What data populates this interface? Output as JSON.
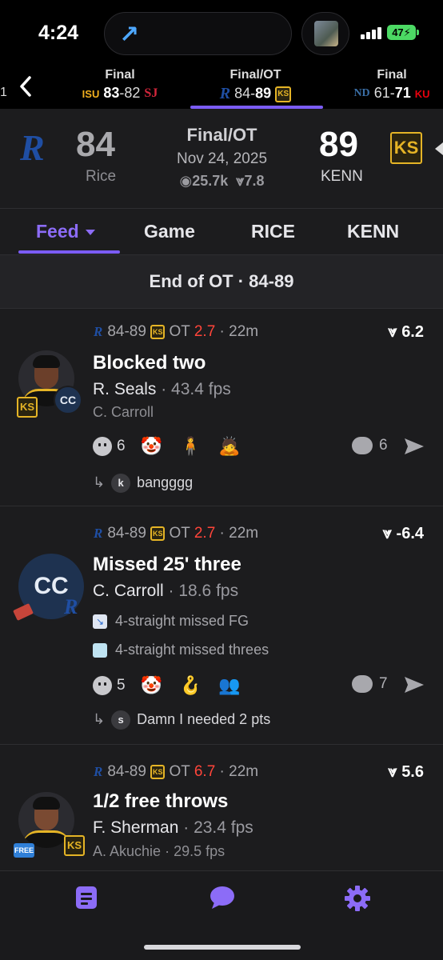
{
  "status_bar": {
    "time": "4:24",
    "battery": "47"
  },
  "scores_strip": {
    "cut_left": "1",
    "games": [
      {
        "status": "Final",
        "away_logo": "ISU",
        "away_score": "83",
        "home_score": "82",
        "home_logo": "SJ",
        "bold": "away"
      },
      {
        "status": "Final/OT",
        "away_logo": "R",
        "away_score": "84",
        "home_score": "89",
        "home_logo": "KS",
        "bold": "home"
      },
      {
        "status": "Final",
        "away_logo": "ND",
        "away_score": "61",
        "home_score": "71",
        "home_logo": "KU",
        "bold": "home"
      }
    ]
  },
  "game": {
    "status": "Final/OT",
    "date": "Nov 24, 2025",
    "views": "25.7k",
    "rating": "7.8",
    "away": {
      "logo": "R",
      "score": "84",
      "name": "Rice"
    },
    "home": {
      "logo": "KS",
      "score": "89",
      "name": "KENN"
    }
  },
  "tabs": [
    "Feed",
    "Game",
    "RICE",
    "KENN"
  ],
  "period_header": "End of OT · 84-89",
  "feed": [
    {
      "score": "84-89",
      "period": "OT",
      "clock": "2.7",
      "ago": "22m",
      "delta": "6.2",
      "title": "Blocked two",
      "player": "R. Seals",
      "player_fps": "43.4 fps",
      "secondary": "C. Carroll",
      "avatar_badge": "CC",
      "reactions": [
        {
          "emoji": "face",
          "count": "6"
        },
        {
          "emoji": "🤡"
        },
        {
          "emoji": "🧍"
        },
        {
          "emoji": "🙇"
        }
      ],
      "comments": "6",
      "reply_initial": "k",
      "reply_text": "bangggg"
    },
    {
      "score": "84-89",
      "period": "OT",
      "clock": "2.7",
      "ago": "22m",
      "delta": "-6.4",
      "title": "Missed 25' three",
      "player": "C. Carroll",
      "player_fps": "18.6 fps",
      "avatar_text": "CC",
      "streaks": [
        "4-straight missed FG",
        "4-straight missed threes"
      ],
      "reactions": [
        {
          "emoji": "face",
          "count": "5"
        },
        {
          "emoji": "🤡"
        },
        {
          "emoji": "🪝"
        },
        {
          "emoji": "👥"
        }
      ],
      "comments": "7",
      "reply_initial": "s",
      "reply_text": "Damn I needed 2 pts"
    },
    {
      "score": "84-89",
      "period": "OT",
      "clock": "6.7",
      "ago": "22m",
      "delta": "5.6",
      "title": "1/2 free throws",
      "player": "F. Sherman",
      "player_fps": "23.4 fps",
      "secondary": "A. Akuchie",
      "secondary_fps": "29.5 fps",
      "free_badge": "FREE"
    }
  ],
  "colors": {
    "accent": "#7b5cf5",
    "red": "#ff453a",
    "background": "#1c1c1e"
  }
}
